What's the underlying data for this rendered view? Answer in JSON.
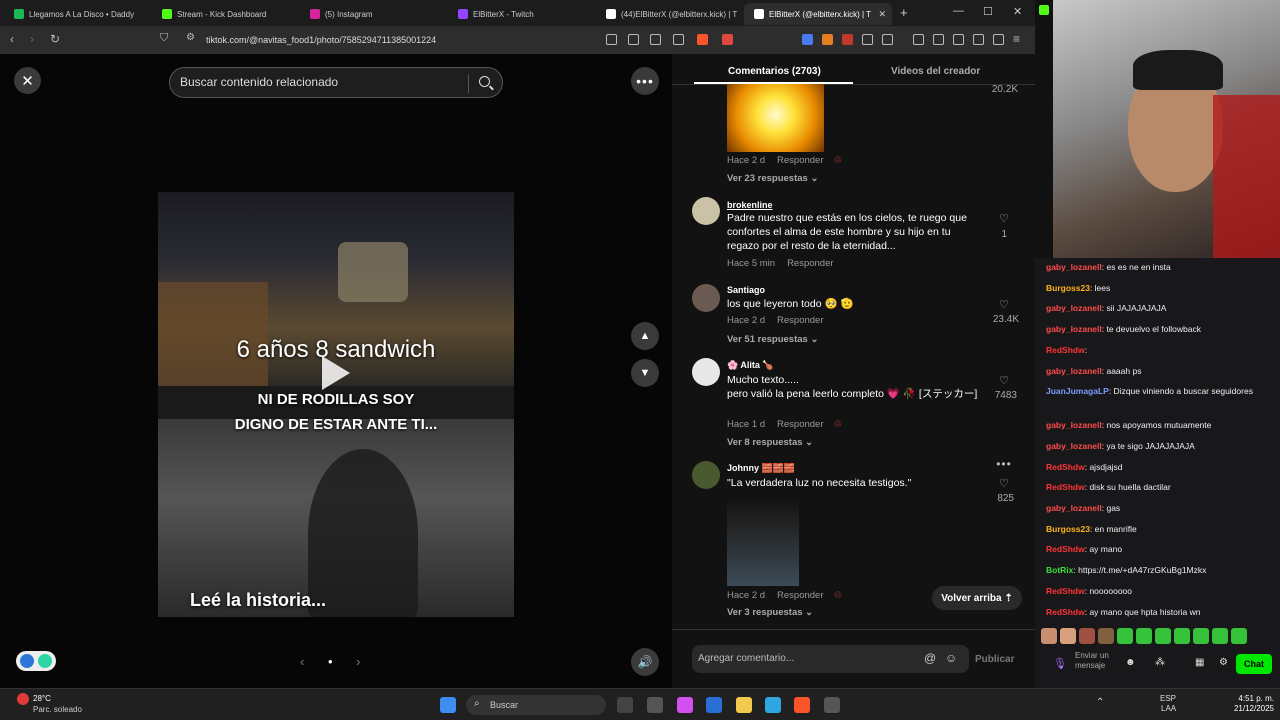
{
  "browser": {
    "tabs": [
      {
        "label": "Llegamos A La Disco • Daddy",
        "color": "#1db954"
      },
      {
        "label": "Stream - Kick Dashboard",
        "color": "#53fc18"
      },
      {
        "label": "(5) Instagram",
        "color": "#d6249f"
      },
      {
        "label": "ElBitterX - Twitch",
        "color": "#9146ff"
      },
      {
        "label": "(44)ElBitterX (@elbitterx.kick) | T",
        "color": "#ffffff"
      },
      {
        "label": "ElBitterX (@elbitterx.kick) | T",
        "color": "#ffffff"
      }
    ],
    "url": "tiktok.com/@navitas_food1/photo/7585294711385001224"
  },
  "viewer": {
    "search_placeholder": "Buscar contenido relacionado",
    "caption_top": "6 años 8 sandwich",
    "caption_mid_1": "NI DE RODILLAS SOY",
    "caption_mid_2": "DIGNO DE ESTAR ANTE TI...",
    "caption_bottom": "Leé la historia..."
  },
  "comments_panel": {
    "tab_comments": "Comentarios (2703)",
    "tab_creator": "Videos del creador",
    "top_like_count": "20.2K",
    "reply_label": "Responder",
    "items": [
      {
        "meta_time": "Hace 2 d",
        "more": "Ver 23 respuestas"
      },
      {
        "user": "brokenline",
        "text": "Padre nuestro que estás en los cielos, te ruego que confortes el alma de este hombre y su hijo en tu regazo por el resto de la eternidad...",
        "time": "Hace 5 min",
        "likes": "1"
      },
      {
        "user": "Santiago",
        "text": "los que leyeron todo 🥺 🫡",
        "time": "Hace 2 d",
        "likes": "23.4K",
        "more": "Ver 51 respuestas"
      },
      {
        "user": "🌸 Alita 🍗",
        "text": "Mucho texto.....\npero valió la pena leerlo completo 💗 🥀 [ステッカー]",
        "time": "Hace 1 d",
        "likes": "7483",
        "more": "Ver 8 respuestas"
      },
      {
        "user": "Johnny 🧱🧱🧱",
        "text": "\"La verdadera luz no necesita testigos.\"",
        "time": "Hace 2 d",
        "likes": "825",
        "more": "Ver 3 respuestas"
      }
    ],
    "back_to_top": "Volver arriba",
    "composer_placeholder": "Agregar comentario...",
    "publish": "Publicar"
  },
  "twitch_chat": {
    "lines": [
      {
        "user": "gaby_lozanell",
        "color": "#ff4b4b",
        "msg": ": es es ne en insta"
      },
      {
        "user": "Burgoss23",
        "color": "#ffb31a",
        "msg": ": lees"
      },
      {
        "user": "gaby_lozanell",
        "color": "#ff4b4b",
        "msg": ": sii JAJAJAJAJA"
      },
      {
        "user": "gaby_lozanell",
        "color": "#ff4b4b",
        "msg": ": te devuelvo el followback"
      },
      {
        "user": "RedShdw",
        "color": "#ff3333",
        "msg": ":"
      },
      {
        "user": "gaby_lozanell",
        "color": "#ff4b4b",
        "msg": ": aaaah ps"
      },
      {
        "user": "JuanJumagaLP",
        "color": "#7a9cff",
        "msg": ": Dizque viniendo a buscar seguidores"
      },
      {
        "user": "gaby_lozanell",
        "color": "#ff4b4b",
        "msg": ": nos apoyamos mutuamente"
      },
      {
        "user": "gaby_lozanell",
        "color": "#ff4b4b",
        "msg": ": ya te sigo JAJAJAJAJA"
      },
      {
        "user": "RedShdw",
        "color": "#ff3333",
        "msg": ": ajsdjajsd"
      },
      {
        "user": "RedShdw",
        "color": "#ff3333",
        "msg": ": disk su huella dactilar"
      },
      {
        "user": "gaby_lozanell",
        "color": "#ff4b4b",
        "msg": ": gas"
      },
      {
        "user": "Burgoss23",
        "color": "#ffb31a",
        "msg": ": en manrifle"
      },
      {
        "user": "RedShdw",
        "color": "#ff3333",
        "msg": ": ay mano"
      },
      {
        "user": "BotRix",
        "color": "#3cdc3c",
        "msg": ": https://t.me/+dA47rzGKuBg1Mzkx"
      },
      {
        "user": "RedShdw",
        "color": "#ff3333",
        "msg": ": noooooooo"
      },
      {
        "user": "RedShdw",
        "color": "#ff3333",
        "msg": ": ay mano que hpta historia wn"
      }
    ],
    "input_placeholder": "Enviar un mensaje",
    "chat_button": "Chat"
  },
  "taskbar": {
    "weather_temp": "28°C",
    "weather_desc": "Parc. soleado",
    "search": "Buscar",
    "lang": "ESP",
    "lang2": "LAA",
    "time": "4:51 p. m.",
    "date": "21/12/2025"
  }
}
